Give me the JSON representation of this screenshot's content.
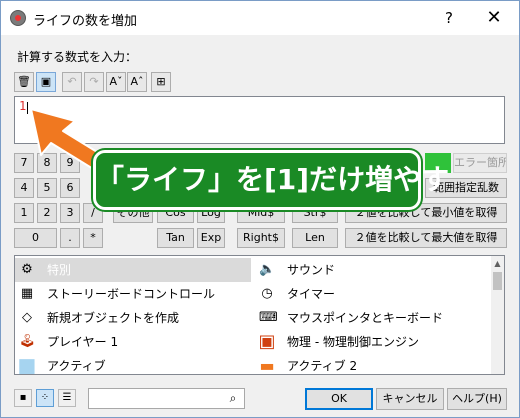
{
  "window": {
    "title": "ライフの数を増加",
    "help_label": "?",
    "close_label": "✕"
  },
  "prompt_label": "計算する数式を入力：",
  "toolbar": [
    {
      "name": "trash-icon",
      "glyph": "🗑"
    },
    {
      "name": "insert-icon",
      "glyph": "▣"
    },
    {
      "name": "undo-icon",
      "glyph": "↶"
    },
    {
      "name": "redo-icon",
      "glyph": "↷"
    },
    {
      "name": "font-smaller-icon",
      "glyph": "Aˇ"
    },
    {
      "name": "font-larger-icon",
      "glyph": "Aˆ"
    },
    {
      "name": "grid-icon",
      "glyph": "⊞"
    }
  ],
  "editor": {
    "value": "1"
  },
  "keypad": {
    "row1": [
      "7",
      "8",
      "9"
    ],
    "row2": [
      "4",
      "5",
      "6"
    ],
    "row3": [
      "1",
      "2",
      "3",
      "/",
      "その他",
      "Cos",
      "Log",
      "Mid$",
      "Str$",
      "２値を比較して最小値を取得"
    ],
    "row4": [
      "0",
      ".",
      "*",
      "Tan",
      "Exp",
      "Right$",
      "Len",
      "２値を比較して最大値を取得"
    ],
    "error_location": "エラー箇所",
    "random_range": "範囲指定乱数"
  },
  "callout": {
    "text": "「ライフ」を[1]だけ増やす",
    "color": "#1a8a25"
  },
  "list": {
    "left": [
      {
        "icon": "gears-icon",
        "glyph": "⚙",
        "label": "特別"
      },
      {
        "icon": "storyboard-icon",
        "glyph": "▦",
        "label": "ストーリーボードコントロール"
      },
      {
        "icon": "new-object-icon",
        "glyph": "◇",
        "label": "新規オブジェクトを作成"
      },
      {
        "icon": "joystick-icon",
        "glyph": "🕹",
        "label": "プレイヤー 1"
      },
      {
        "icon": "active-icon",
        "glyph": "■",
        "label": "アクティブ"
      }
    ],
    "right": [
      {
        "icon": "speaker-icon",
        "glyph": "🔈",
        "label": "サウンド"
      },
      {
        "icon": "timer-icon",
        "glyph": "◷",
        "label": "タイマー"
      },
      {
        "icon": "keyboard-icon",
        "glyph": "⌨",
        "label": "マウスポインタとキーボード"
      },
      {
        "icon": "physics-icon",
        "glyph": "▣",
        "label": "物理 - 物理制御エンジン"
      },
      {
        "icon": "active2-icon",
        "glyph": "▬",
        "label": "アクティブ 2"
      }
    ]
  },
  "search": {
    "value": ""
  },
  "buttons": {
    "ok": "OK",
    "cancel": "キャンセル",
    "help": "ヘルプ(H)"
  },
  "colors": {
    "accent": "#0078d7",
    "highlight_green": "#2fc23a",
    "arrow": "#f07820"
  }
}
